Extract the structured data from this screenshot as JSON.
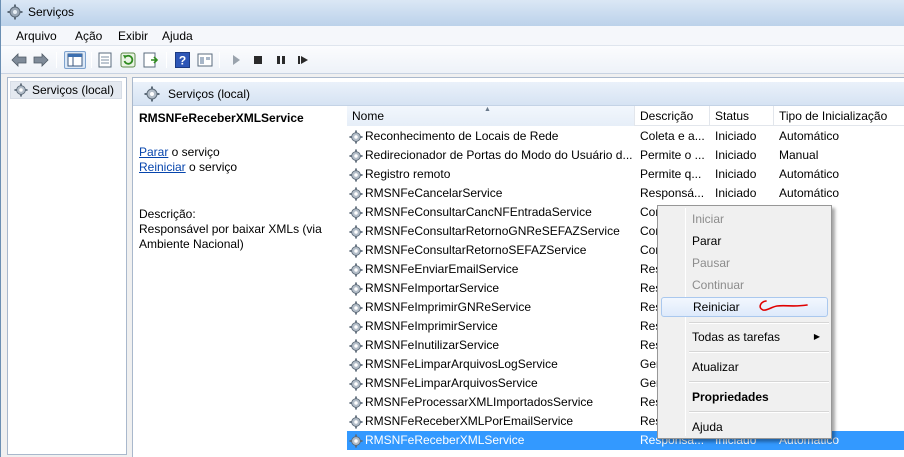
{
  "window": {
    "title": "Serviços"
  },
  "menu": [
    "Arquivo",
    "Ação",
    "Exibir",
    "Ajuda"
  ],
  "toolbar": {
    "icons": [
      "back-arrow-icon",
      "forward-arrow-icon",
      "console-tree-icon",
      "properties-sheet-icon",
      "refresh-icon",
      "export-list-icon",
      "help-icon",
      "view-icon",
      "play-icon",
      "stop-icon",
      "pause-icon",
      "restart-icon"
    ]
  },
  "tree": {
    "root_label": "Serviços (local)"
  },
  "panel": {
    "header": "Serviços (local)",
    "selected_service": "RMSNFeReceberXMLService",
    "stop_link": "Parar",
    "stop_suffix": " o serviço",
    "restart_link": "Reiniciar",
    "restart_suffix": " o serviço",
    "description_label": "Descrição:",
    "description_text": "Responsável por baixar XMLs (via Ambiente Nacional)"
  },
  "columns": {
    "name": "Nome",
    "description": "Descrição",
    "status": "Status",
    "startup": "Tipo de Inicialização"
  },
  "rows": [
    {
      "name": "Reconhecimento de Locais de Rede",
      "description": "Coleta e a...",
      "status": "Iniciado",
      "startup": "Automático"
    },
    {
      "name": "Redirecionador de Portas do Modo do Usuário d...",
      "description": "Permite o ...",
      "status": "Iniciado",
      "startup": "Manual"
    },
    {
      "name": "Registro remoto",
      "description": "Permite q...",
      "status": "Iniciado",
      "startup": "Automático"
    },
    {
      "name": "RMSNFeCancelarService",
      "description": "Responsá...",
      "status": "Iniciado",
      "startup": "Automático"
    },
    {
      "name": "RMSNFeConsultarCancNFEntradaService",
      "description": "Con",
      "status": "",
      "startup": ""
    },
    {
      "name": "RMSNFeConsultarRetornoGNReSEFAZService",
      "description": "Con",
      "status": "",
      "startup": ""
    },
    {
      "name": "RMSNFeConsultarRetornoSEFAZService",
      "description": "Con",
      "status": "",
      "startup": ""
    },
    {
      "name": "RMSNFeEnviarEmailService",
      "description": "Res",
      "status": "",
      "startup": ""
    },
    {
      "name": "RMSNFeImportarService",
      "description": "Res",
      "status": "",
      "startup": ""
    },
    {
      "name": "RMSNFeImprimirGNReService",
      "description": "Res",
      "status": "",
      "startup": ""
    },
    {
      "name": "RMSNFeImprimirService",
      "description": "Res",
      "status": "",
      "startup": ""
    },
    {
      "name": "RMSNFeInutilizarService",
      "description": "Res",
      "status": "",
      "startup": ""
    },
    {
      "name": "RMSNFeLimparArquivosLogService",
      "description": "Ger",
      "status": "",
      "startup": ""
    },
    {
      "name": "RMSNFeLimparArquivosService",
      "description": "Ger",
      "status": "",
      "startup": ""
    },
    {
      "name": "RMSNFeProcessarXMLImportadosService",
      "description": "Res",
      "status": "",
      "startup": ""
    },
    {
      "name": "RMSNFeReceberXMLPorEmailService",
      "description": "Res",
      "status": "",
      "startup": ""
    },
    {
      "name": "RMSNFeReceberXMLService",
      "description": "Responsá...",
      "status": "Iniciado",
      "startup": "Automático"
    }
  ],
  "context_menu": {
    "start": "Iniciar",
    "stop": "Parar",
    "pause": "Pausar",
    "resume": "Continuar",
    "restart": "Reiniciar",
    "all_tasks": "Todas as tarefas",
    "refresh": "Atualizar",
    "properties": "Propriedades",
    "help": "Ajuda"
  },
  "colors": {
    "selection": "#3399ff",
    "annotation": "#e00000"
  }
}
